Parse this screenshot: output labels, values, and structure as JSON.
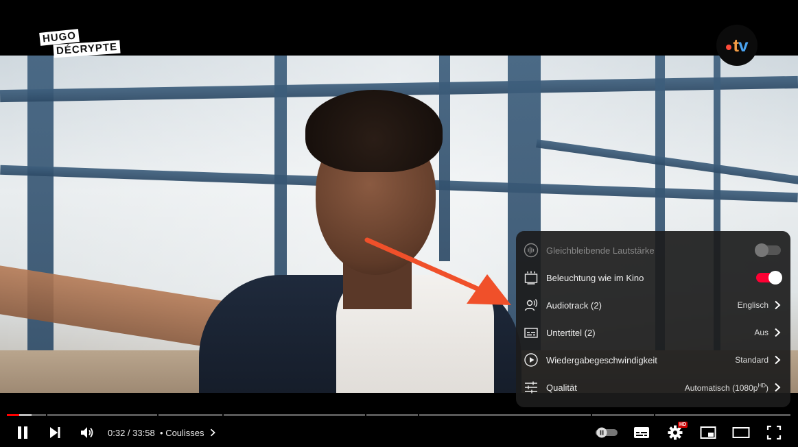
{
  "channel": {
    "logo_line1": "HUGO",
    "logo_line2": "DÉCRYPTE"
  },
  "broadcaster": {
    "logo_text_t": "t",
    "logo_text_v": "v",
    "colors": {
      "dot": "#ff4b3a",
      "t": "#f39b45",
      "v": "#4aa3f0"
    }
  },
  "settings_menu": {
    "items": [
      {
        "icon": "stable-volume-icon",
        "label": "Gleichbleibende Lautstärke",
        "control": "toggle",
        "state": "off",
        "disabled": true
      },
      {
        "icon": "ambient-mode-icon",
        "label": "Beleuchtung wie im Kino",
        "control": "toggle",
        "state": "on"
      },
      {
        "icon": "audio-track-icon",
        "label": "Audiotrack (2)",
        "value": "Englisch"
      },
      {
        "icon": "subtitles-icon",
        "label": "Untertitel (2)",
        "value": "Aus"
      },
      {
        "icon": "playback-speed-icon",
        "label": "Wiedergabegeschwindigkeit",
        "value": "Standard"
      },
      {
        "icon": "quality-icon",
        "label": "Qualität",
        "value": "Automatisch (1080p",
        "value_sup": "HD",
        "value_suffix": ")"
      }
    ]
  },
  "player": {
    "current_time": "0:32",
    "duration": "33:58",
    "time_separator": " / ",
    "chapter_bullet": "•",
    "chapter": "Coulisses",
    "hd_badge": "HD",
    "progress_fraction": 0.0157,
    "accent_color": "#ff0000"
  }
}
